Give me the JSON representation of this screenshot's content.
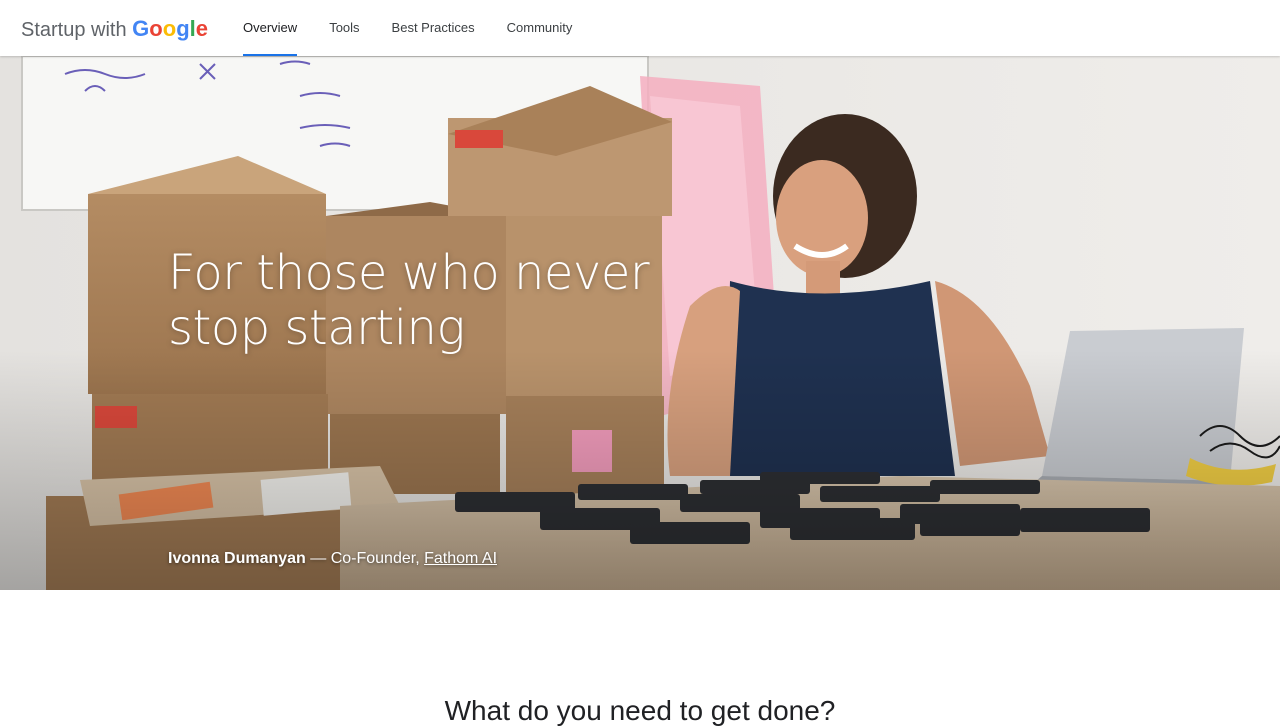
{
  "header": {
    "brand_prefix": "Startup with ",
    "brand_letters": [
      "G",
      "o",
      "o",
      "g",
      "l",
      "e"
    ],
    "brand_colors": [
      "#4285F4",
      "#EA4335",
      "#FBBC05",
      "#4285F4",
      "#34A853",
      "#EA4335"
    ],
    "nav_tabs": [
      {
        "label": "Overview",
        "active": true
      },
      {
        "label": "Tools",
        "active": false
      },
      {
        "label": "Best Practices",
        "active": false
      },
      {
        "label": "Community",
        "active": false
      }
    ],
    "active_tab_color": "#1a73e8"
  },
  "hero": {
    "headline": "For those who never stop starting",
    "caption": {
      "name": "Ivonna Dumanyan",
      "separator": " — ",
      "role": "Co-Founder, ",
      "company": "Fathom AI"
    },
    "photo_description_icon": "photo-of-founder-at-desk"
  },
  "section": {
    "heading": "What do you need to get done?"
  }
}
